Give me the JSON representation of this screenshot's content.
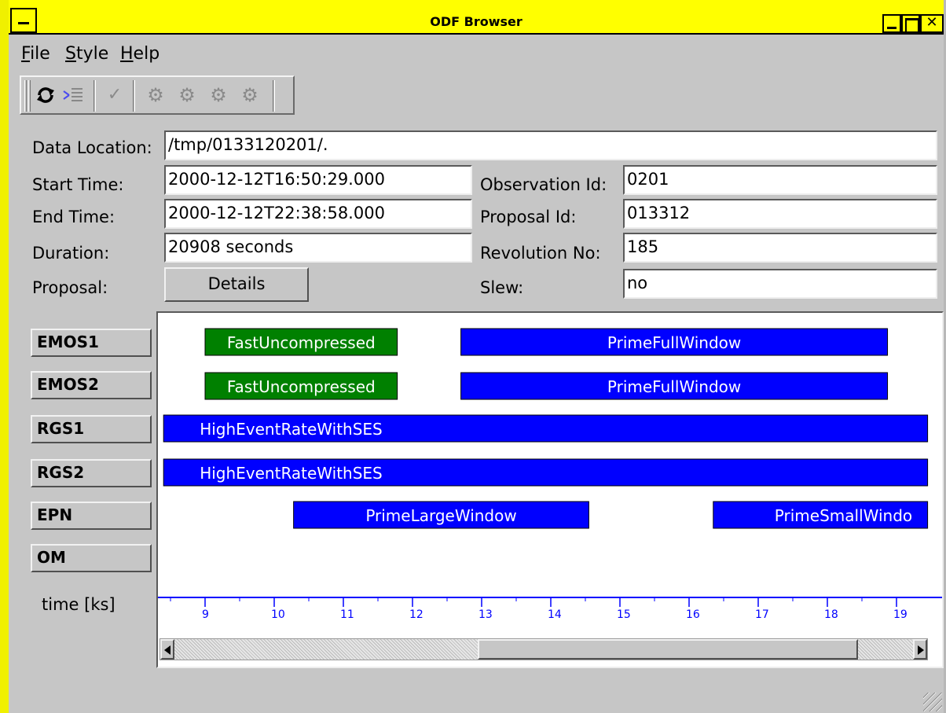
{
  "window": {
    "title": "ODF Browser"
  },
  "menu": {
    "file": {
      "accel": "F",
      "rest": "ile"
    },
    "style": {
      "accel": "S",
      "rest": "tyle"
    },
    "help": {
      "accel": "H",
      "rest": "elp"
    }
  },
  "toolbar": {
    "icons": [
      "refresh-icon",
      "filter-icon",
      "check-icon",
      "gear-icon",
      "gear-icon",
      "gear-icon",
      "gear-icon"
    ]
  },
  "fields": {
    "data_location": {
      "label": "Data Location:",
      "value": "/tmp/0133120201/."
    },
    "start_time": {
      "label": "Start Time:",
      "value": "2000-12-12T16:50:29.000"
    },
    "end_time": {
      "label": "End Time:",
      "value": "2000-12-12T22:38:58.000"
    },
    "duration": {
      "label": "Duration:",
      "value": "20908 seconds"
    },
    "proposal": {
      "label": "Proposal:",
      "button": "Details"
    },
    "observation_id": {
      "label": "Observation Id:",
      "value": "0201"
    },
    "proposal_id": {
      "label": "Proposal Id:",
      "value": "013312"
    },
    "revolution_no": {
      "label": "Revolution No:",
      "value": "185"
    },
    "slew": {
      "label": "Slew:",
      "value": "no"
    }
  },
  "instruments": [
    "EMOS1",
    "EMOS2",
    "RGS1",
    "RGS2",
    "EPN",
    "OM"
  ],
  "time_label": "time [ks]",
  "chart_data": {
    "type": "timeline",
    "xlabel": "time [ks]",
    "x_ticks": [
      9,
      10,
      11,
      12,
      13,
      14,
      15,
      16,
      17,
      18,
      19
    ],
    "visible_range": [
      8.4,
      19.45
    ],
    "rows": [
      {
        "instrument": "EMOS1",
        "segments": [
          {
            "label": "FastUncompressed",
            "start": 9.0,
            "end": 11.78,
            "color": "#008000"
          },
          {
            "label": "PrimeFullWindow",
            "start": 12.7,
            "end": 18.87,
            "color": "#0000ff"
          }
        ]
      },
      {
        "instrument": "EMOS2",
        "segments": [
          {
            "label": "FastUncompressed",
            "start": 9.0,
            "end": 11.78,
            "color": "#008000"
          },
          {
            "label": "PrimeFullWindow",
            "start": 12.7,
            "end": 18.87,
            "color": "#0000ff"
          }
        ]
      },
      {
        "instrument": "RGS1",
        "segments": [
          {
            "label": "HighEventRateWithSES",
            "start": 8.4,
            "end": 19.45,
            "color": "#0000ff"
          }
        ]
      },
      {
        "instrument": "RGS2",
        "segments": [
          {
            "label": "HighEventRateWithSES",
            "start": 8.4,
            "end": 19.45,
            "color": "#0000ff"
          }
        ]
      },
      {
        "instrument": "EPN",
        "segments": [
          {
            "label": "PrimeLargeWindow",
            "start": 10.28,
            "end": 14.55,
            "color": "#0000ff"
          },
          {
            "label": "PrimeSmallWindo",
            "start": 16.35,
            "end": 19.45,
            "color": "#0000ff"
          }
        ]
      },
      {
        "instrument": "OM",
        "segments": []
      }
    ]
  },
  "scrollbar": {
    "position": 0.41
  }
}
